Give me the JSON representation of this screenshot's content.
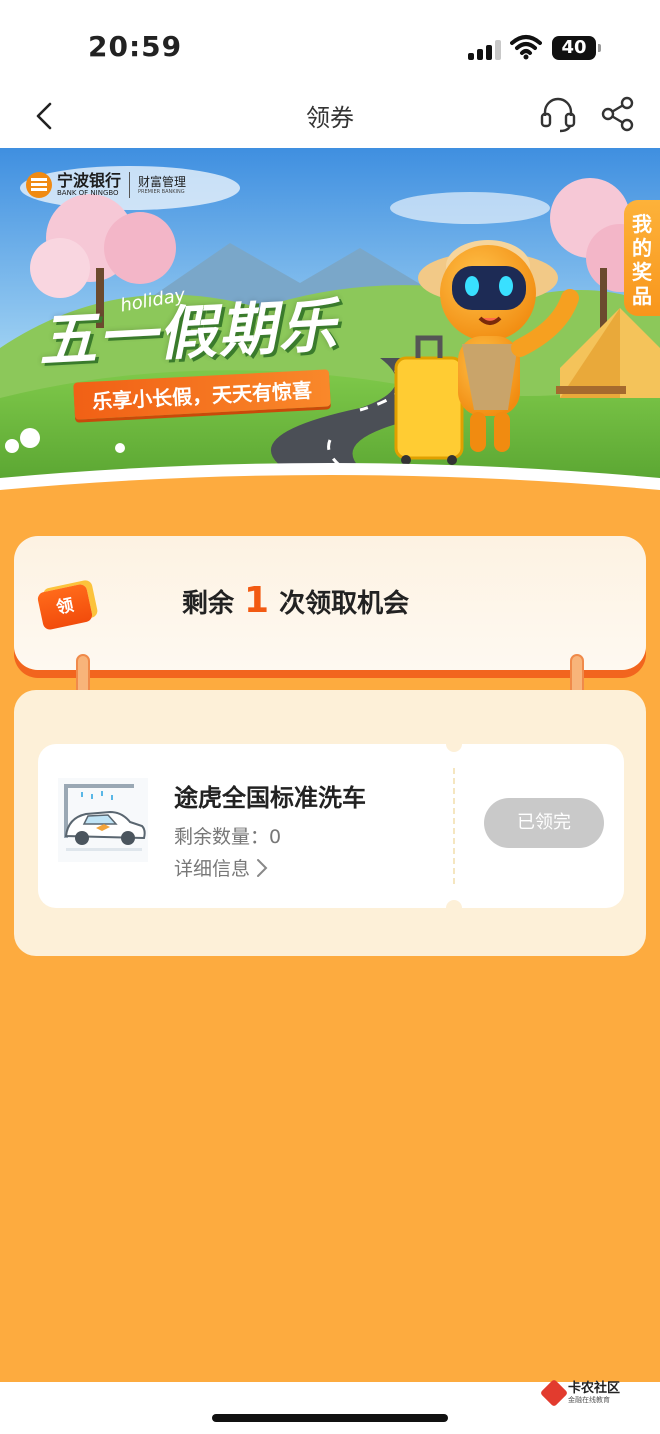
{
  "status_bar": {
    "time": "20:59",
    "battery": "40"
  },
  "nav": {
    "title": "领券"
  },
  "banner": {
    "bank_name_cn": "宁波银行",
    "bank_name_en": "BANK OF NINGBO",
    "division_cn": "财富管理",
    "division_en": "PREMIER BANKING",
    "headline": "五一假期乐",
    "headline_en": "holiday",
    "slogan": "乐享小长假，天天有惊喜",
    "my_prize": "我的奖品"
  },
  "chance": {
    "badge": "领",
    "prefix": "剩余",
    "count": "1",
    "suffix": "次领取机会"
  },
  "coupon": {
    "name": "途虎全国标准洗车",
    "remaining_label": "剩余数量：",
    "remaining_value": "0",
    "detail_label": "详细信息",
    "button_label": "已领完"
  },
  "watermark": {
    "name": "卡农社区",
    "sub": "金融在线教育"
  },
  "colors": {
    "page_bg": "#fdab3f",
    "accent_orange": "#f25a12",
    "button_disabled": "#c9c9c9",
    "panel_bg": "#fdf0d8"
  }
}
